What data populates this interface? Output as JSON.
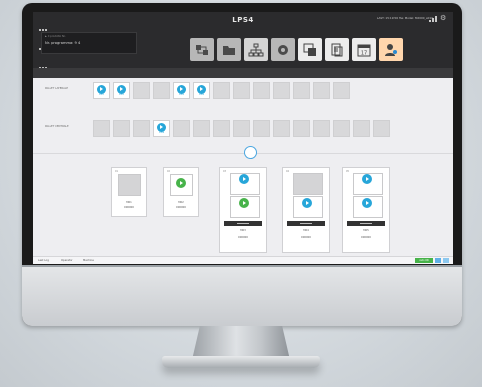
{
  "app": {
    "title": "LPS4",
    "status_line1": "► Il prodotto Nr.",
    "status_line2": "Nr. programma: 9 4",
    "top_right_text": "LAST: 15:19:56  Hw. Model: M2000_e010"
  },
  "toolbar": {
    "buttons": [
      {
        "name": "transfer-icon",
        "color": "#b0b0b0"
      },
      {
        "name": "folder-icon",
        "color": "#b0b0b0"
      },
      {
        "name": "network-icon",
        "color": "#d0d0d0"
      },
      {
        "name": "settings-icon",
        "color": "#b0b0b0"
      },
      {
        "name": "chart-window-icon",
        "color": "#e8e8e8"
      },
      {
        "name": "document-icon",
        "color": "#e8e8e8"
      },
      {
        "name": "calendar-icon",
        "color": "#e8e8e8"
      },
      {
        "name": "user-icon",
        "color": "#ffd7b0"
      }
    ],
    "calendar_day": "17"
  },
  "main": {
    "row1_label": "PALLET LATERALE",
    "row2_label": "PALLET CENTRALE",
    "row1_tiles": [
      {
        "on": true,
        "label": "2001"
      },
      {
        "on": true,
        "label": "2002"
      },
      {
        "on": false,
        "label": ""
      },
      {
        "on": false,
        "label": ""
      },
      {
        "on": true,
        "label": "2005"
      },
      {
        "on": true,
        "label": "2006"
      },
      {
        "on": false,
        "label": ""
      },
      {
        "on": false,
        "label": ""
      },
      {
        "on": false,
        "label": ""
      },
      {
        "on": false,
        "label": ""
      },
      {
        "on": false,
        "label": ""
      },
      {
        "on": false,
        "label": ""
      },
      {
        "on": false,
        "label": ""
      }
    ],
    "row2_tiles": [
      {
        "on": false,
        "label": ""
      },
      {
        "on": false,
        "label": ""
      },
      {
        "on": false,
        "label": ""
      },
      {
        "on": true,
        "label": "2004"
      },
      {
        "on": false,
        "label": ""
      },
      {
        "on": false,
        "label": ""
      },
      {
        "on": false,
        "label": ""
      },
      {
        "on": false,
        "label": ""
      },
      {
        "on": false,
        "label": ""
      },
      {
        "on": false,
        "label": ""
      },
      {
        "on": false,
        "label": ""
      },
      {
        "on": false,
        "label": ""
      },
      {
        "on": false,
        "label": ""
      },
      {
        "on": false,
        "label": ""
      },
      {
        "on": false,
        "label": ""
      }
    ]
  },
  "cards": [
    {
      "num": "01",
      "title": "M01",
      "sub": "000000"
    },
    {
      "num": "02",
      "title": "M02",
      "sub": "000000"
    },
    {
      "num": "03",
      "title": "M03",
      "sub": "000000"
    },
    {
      "num": "04",
      "title": "M04",
      "sub": "000000"
    },
    {
      "num": "05",
      "title": "M05",
      "sub": "000000"
    }
  ],
  "footer": {
    "item1": "Last Log",
    "item2": "Operator",
    "item3": "Machine",
    "green_label": "Auto ON"
  }
}
